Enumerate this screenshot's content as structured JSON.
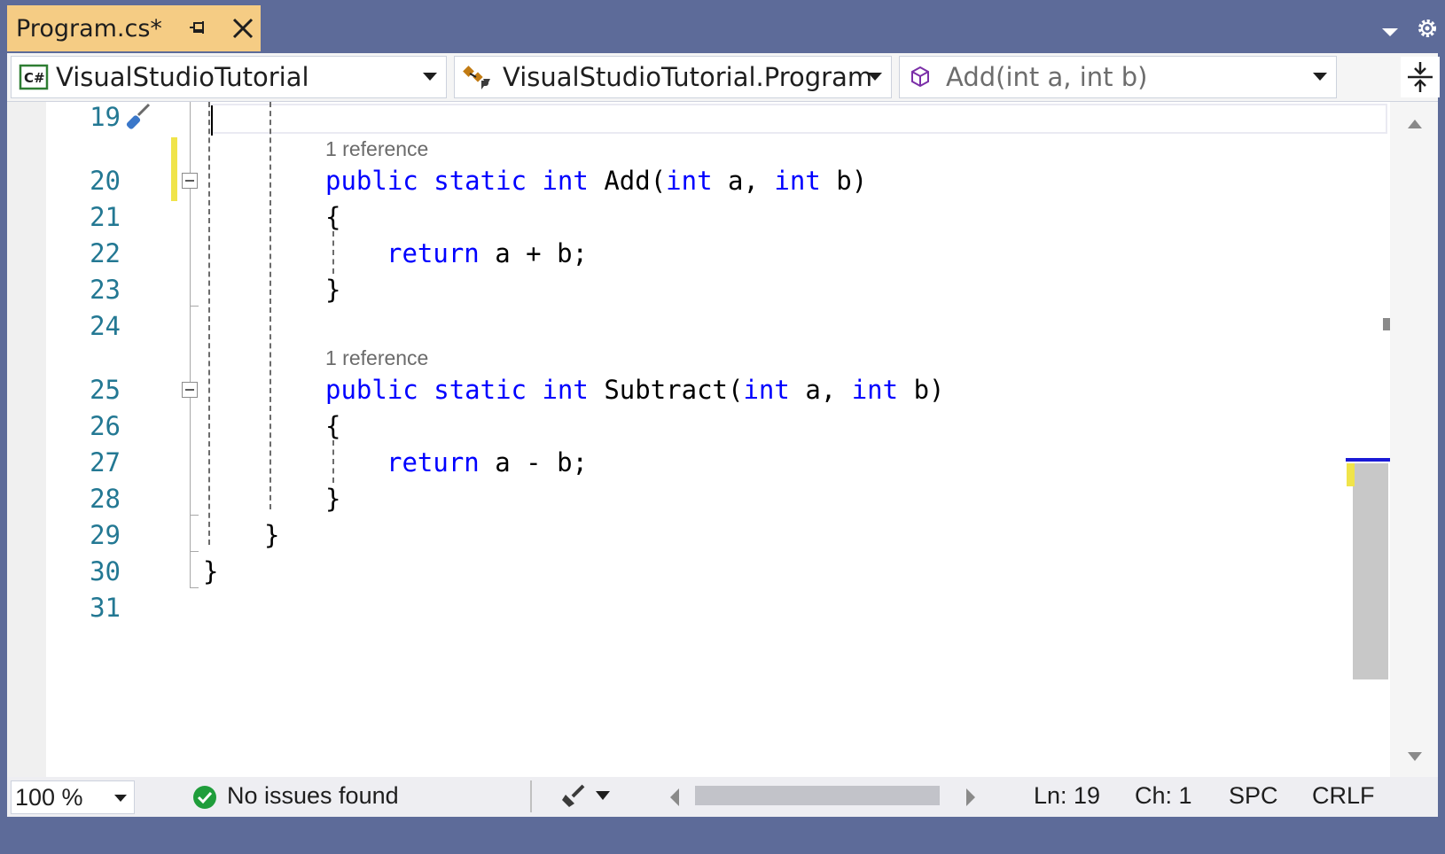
{
  "tab": {
    "title": "Program.cs*"
  },
  "navigation": {
    "project": "VisualStudioTutorial",
    "type": "VisualStudioTutorial.Program",
    "member": "Add(int a, int b)"
  },
  "editor": {
    "line_numbers": [
      "19",
      "20",
      "21",
      "22",
      "23",
      "24",
      "25",
      "26",
      "27",
      "28",
      "29",
      "30",
      "31"
    ],
    "codelens": [
      "1 reference",
      "1 reference"
    ],
    "code": {
      "l20": {
        "kw1": "public",
        "kw2": "static",
        "kw3": "int",
        "name": "Add(",
        "kw4": "int",
        "a": "a,",
        "kw5": "int",
        "b": "b)"
      },
      "l21": "{",
      "l22": {
        "kw": "return",
        "expr": "a + b;"
      },
      "l23": "}",
      "l25": {
        "kw1": "public",
        "kw2": "static",
        "kw3": "int",
        "name": "Subtract(",
        "kw4": "int",
        "a": "a,",
        "kw5": "int",
        "b": "b)"
      },
      "l26": "{",
      "l27": {
        "kw": "return",
        "expr": "a - b;"
      },
      "l28": "}",
      "l29": "}",
      "l30": "}"
    }
  },
  "status": {
    "zoom": "100 %",
    "issues": "No issues found",
    "line": "Ln: 19",
    "col": "Ch: 1",
    "whitespace": "SPC",
    "line_ending": "CRLF"
  },
  "colors": {
    "keyword": "#0000ff",
    "line_number": "#237893",
    "tab_active": "#f5cc84",
    "frame": "#5d6b99",
    "change_marker": "#f0e44a"
  }
}
